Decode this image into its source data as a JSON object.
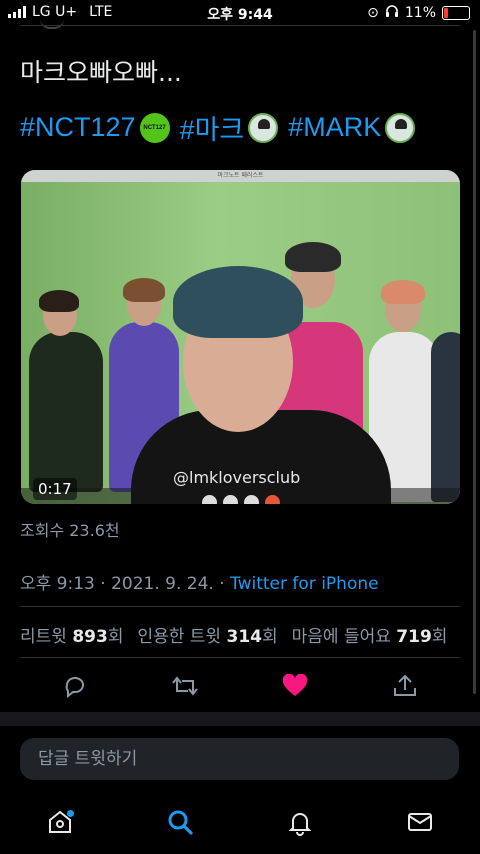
{
  "status_bar": {
    "carrier": "LG U+",
    "network": "LTE",
    "time": "오후 9:44",
    "battery": "11%"
  },
  "tweet": {
    "text": "마크오빠오빠...",
    "hashtags": [
      "#NCT127",
      "#마크",
      "#MARK"
    ],
    "hashtag_emoji": [
      "NCT127"
    ],
    "video": {
      "duration": "0:17",
      "watermark": "@lmkloversclub",
      "window_title": "마크노트 패러스트"
    },
    "views": "조회수 23.6천",
    "time": "오후 9:13",
    "date": "2021. 9. 24.",
    "separator": "·",
    "source": "Twitter for iPhone"
  },
  "stats": {
    "retweets_label": "리트윗",
    "retweets": "893",
    "retweets_unit": "회",
    "quotes_label": "인용한 트윗",
    "quotes": "314",
    "quotes_unit": "회",
    "likes_label": "마음에 들어요",
    "likes": "719",
    "likes_unit": "회"
  },
  "actions": [
    "reply-icon",
    "retweet-icon",
    "like-icon",
    "share-icon"
  ],
  "colors": {
    "accent": "#1d9bf0",
    "like": "#f91880",
    "background": "#000000"
  },
  "reply_box": {
    "placeholder": "답글 트윗하기"
  },
  "tabbar": [
    "home-icon",
    "search-icon",
    "notifications-icon",
    "messages-icon"
  ]
}
